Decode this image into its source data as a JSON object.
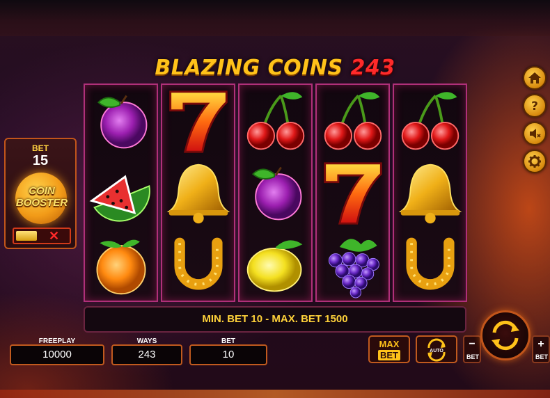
{
  "game": {
    "title_part1": "BLAZING COINS",
    "title_part2": "243"
  },
  "reels": [
    [
      "plum-icon",
      "watermelon-icon",
      "orange-icon"
    ],
    [
      "seven-icon",
      "bell-icon",
      "horseshoe-icon"
    ],
    [
      "cherries-icon",
      "plum-icon",
      "lemon-icon"
    ],
    [
      "cherries-icon",
      "seven-icon",
      "grapes-icon"
    ],
    [
      "cherries-icon",
      "bell-icon",
      "horseshoe-icon"
    ]
  ],
  "booster": {
    "bet_label": "BET",
    "bet_value": "15",
    "coin_line1": "COIN",
    "coin_line2": "BOOSTER",
    "toggle_off_symbol": "✕"
  },
  "side_buttons": [
    "home-icon",
    "help-icon",
    "sound-off-icon",
    "settings-icon"
  ],
  "info": {
    "message": "MIN. BET 10 - MAX. BET 1500"
  },
  "fields": {
    "freeplay_label": "FREEPLAY",
    "freeplay_value": "10000",
    "ways_label": "WAYS",
    "ways_value": "243",
    "bet_label": "BET",
    "bet_value": "10"
  },
  "controls": {
    "max_bet_line1": "MAX",
    "max_bet_line2": "BET",
    "auto_label": "AUTO",
    "bet_minus_sign": "−",
    "bet_minus_label": "BET",
    "bet_plus_sign": "+",
    "bet_plus_label": "BET",
    "spin_icon": "spin-icon"
  },
  "colors": {
    "title_gold": "#ffc21a",
    "title_red": "#ff2a2a",
    "reel_border": "#b0307a",
    "ui_orange": "#c15a1e",
    "info_text": "#ffd23a"
  }
}
